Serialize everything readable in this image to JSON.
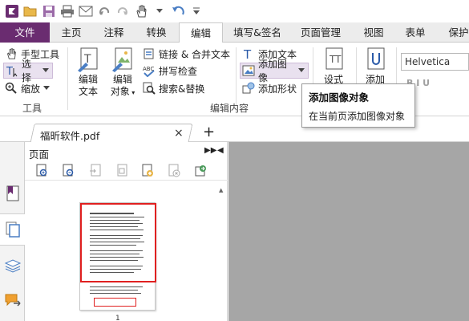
{
  "quick_access": {
    "icons": [
      "app-logo-icon",
      "open-icon",
      "save-icon",
      "print-icon",
      "email-icon",
      "undo-icon",
      "redo-icon",
      "hand-icon",
      "undo-arrow-icon",
      "more-icon"
    ]
  },
  "tabs": [
    {
      "label": "文件"
    },
    {
      "label": "主页"
    },
    {
      "label": "注释"
    },
    {
      "label": "转换"
    },
    {
      "label": "编辑"
    },
    {
      "label": "填写&签名"
    },
    {
      "label": "页面管理"
    },
    {
      "label": "视图"
    },
    {
      "label": "表单"
    },
    {
      "label": "保护"
    }
  ],
  "ribbon": {
    "tools": {
      "hand": "手型工具",
      "select": "选择",
      "zoom": "缩放",
      "group_label": "工具"
    },
    "edit": {
      "edit_text": "编辑\n文本",
      "edit_object": "编辑\n对象",
      "link_merge": "链接 & 合并文本",
      "spell_check": "拼写检查",
      "search_replace": "搜索&替换",
      "add_text": "添加文本",
      "add_image": "添加图像",
      "add_shape": "添加形状",
      "format_style": "设式",
      "add_more": "添加",
      "group_label": "编辑内容"
    },
    "font_name": "Helvetica",
    "format_marks": "B  I  U"
  },
  "tooltip": {
    "title": "添加图像对象",
    "description": "在当前页添加图像对象"
  },
  "document_tab": {
    "filename": "福昕软件.pdf",
    "close": "×",
    "new_tab": "+"
  },
  "pages_panel": {
    "title": "页面",
    "page_number": "1"
  },
  "colors": {
    "brand": "#6a2c70",
    "selection": "#e02020",
    "doc_background": "#a6a6a6"
  }
}
